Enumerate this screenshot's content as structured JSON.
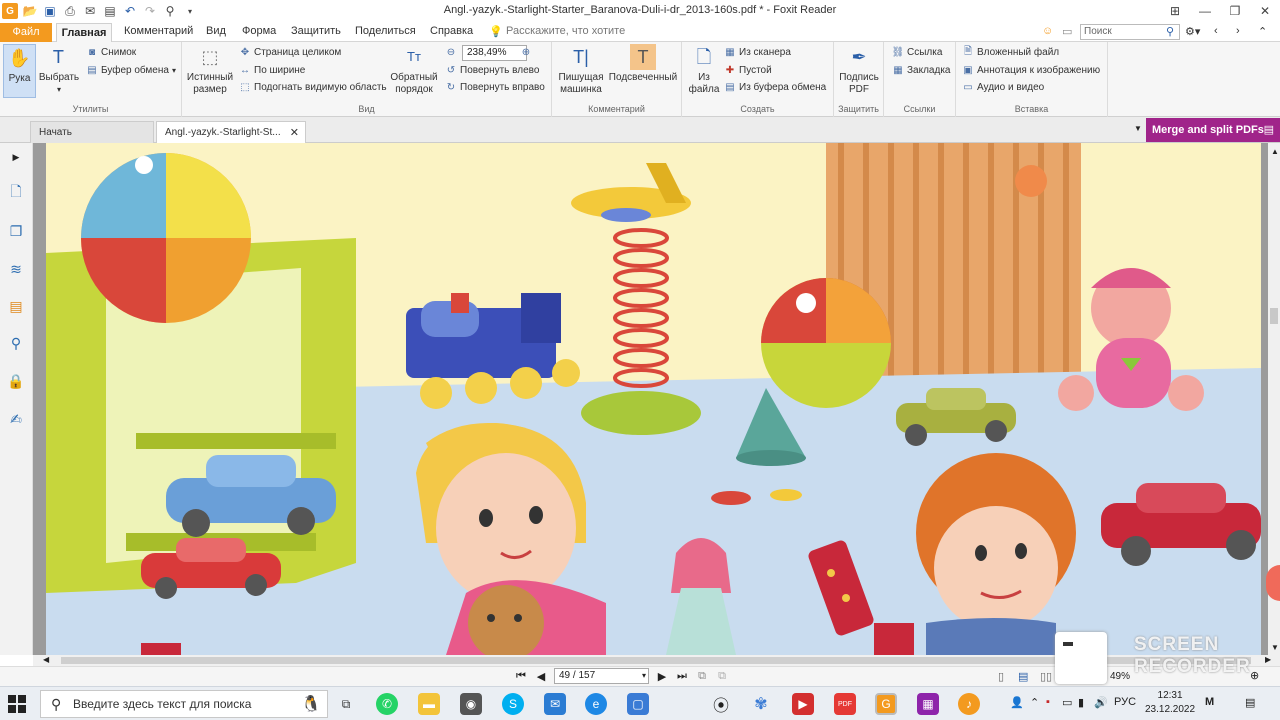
{
  "window": {
    "title": "Angl.-yazyk.-Starlight-Starter_Baranova-Duli-i-dr_2013-160s.pdf * - Foxit Reader"
  },
  "menu": {
    "file": "Файл",
    "home": "Главная",
    "items": [
      "Комментарий",
      "Вид",
      "Форма",
      "Защитить",
      "Поделиться",
      "Справка"
    ],
    "tell_me": "Расскажите, что хотите",
    "search_placeholder": "Поиск"
  },
  "ribbon": {
    "utilities": {
      "label": "Утилиты",
      "hand": "Рука",
      "select": "Выбрать",
      "snapshot": "Снимок",
      "clipboard": "Буфер обмена"
    },
    "view": {
      "label": "Вид",
      "actual_size_1": "Истинный",
      "actual_size_2": "размер",
      "fit_page": "Страница целиком",
      "fit_width": "По ширине",
      "fit_visible": "Подогнать видимую область",
      "reverse_1": "Обратный",
      "reverse_2": "порядок",
      "zoom": "238,49%",
      "rotate_left": "Повернуть влево",
      "rotate_right": "Повернуть вправо"
    },
    "comment": {
      "label": "Комментарий",
      "typewriter_1": "Пишущая",
      "typewriter_2": "машинка",
      "highlight": "Подсвеченный"
    },
    "create": {
      "label": "Создать",
      "from_file_1": "Из",
      "from_file_2": "файла",
      "from_scanner": "Из сканера",
      "blank": "Пустой",
      "from_clipboard": "Из буфера обмена"
    },
    "protect": {
      "label": "Защитить",
      "sign_1": "Подпись",
      "sign_2": "PDF"
    },
    "links": {
      "label": "Ссылки",
      "link": "Ссылка",
      "bookmark": "Закладка"
    },
    "insert": {
      "label": "Вставка",
      "attachment": "Вложенный файл",
      "image_annotation": "Аннотация к изображению",
      "audio_video": "Аудио и видео"
    }
  },
  "tabs": {
    "start": "Начать",
    "document": "Angl.-yazyk.-Starlight-St...",
    "merge": "Merge and split PDFs"
  },
  "status": {
    "page": "49 / 157",
    "zoom_partial": "49%"
  },
  "recorder": {
    "line1": "SCREEN",
    "line2": "RECORDER"
  },
  "taskbar": {
    "search": "Введите здесь текст для поиска",
    "lang": "РУС",
    "time": "12:31",
    "date": "23.12.2022"
  }
}
